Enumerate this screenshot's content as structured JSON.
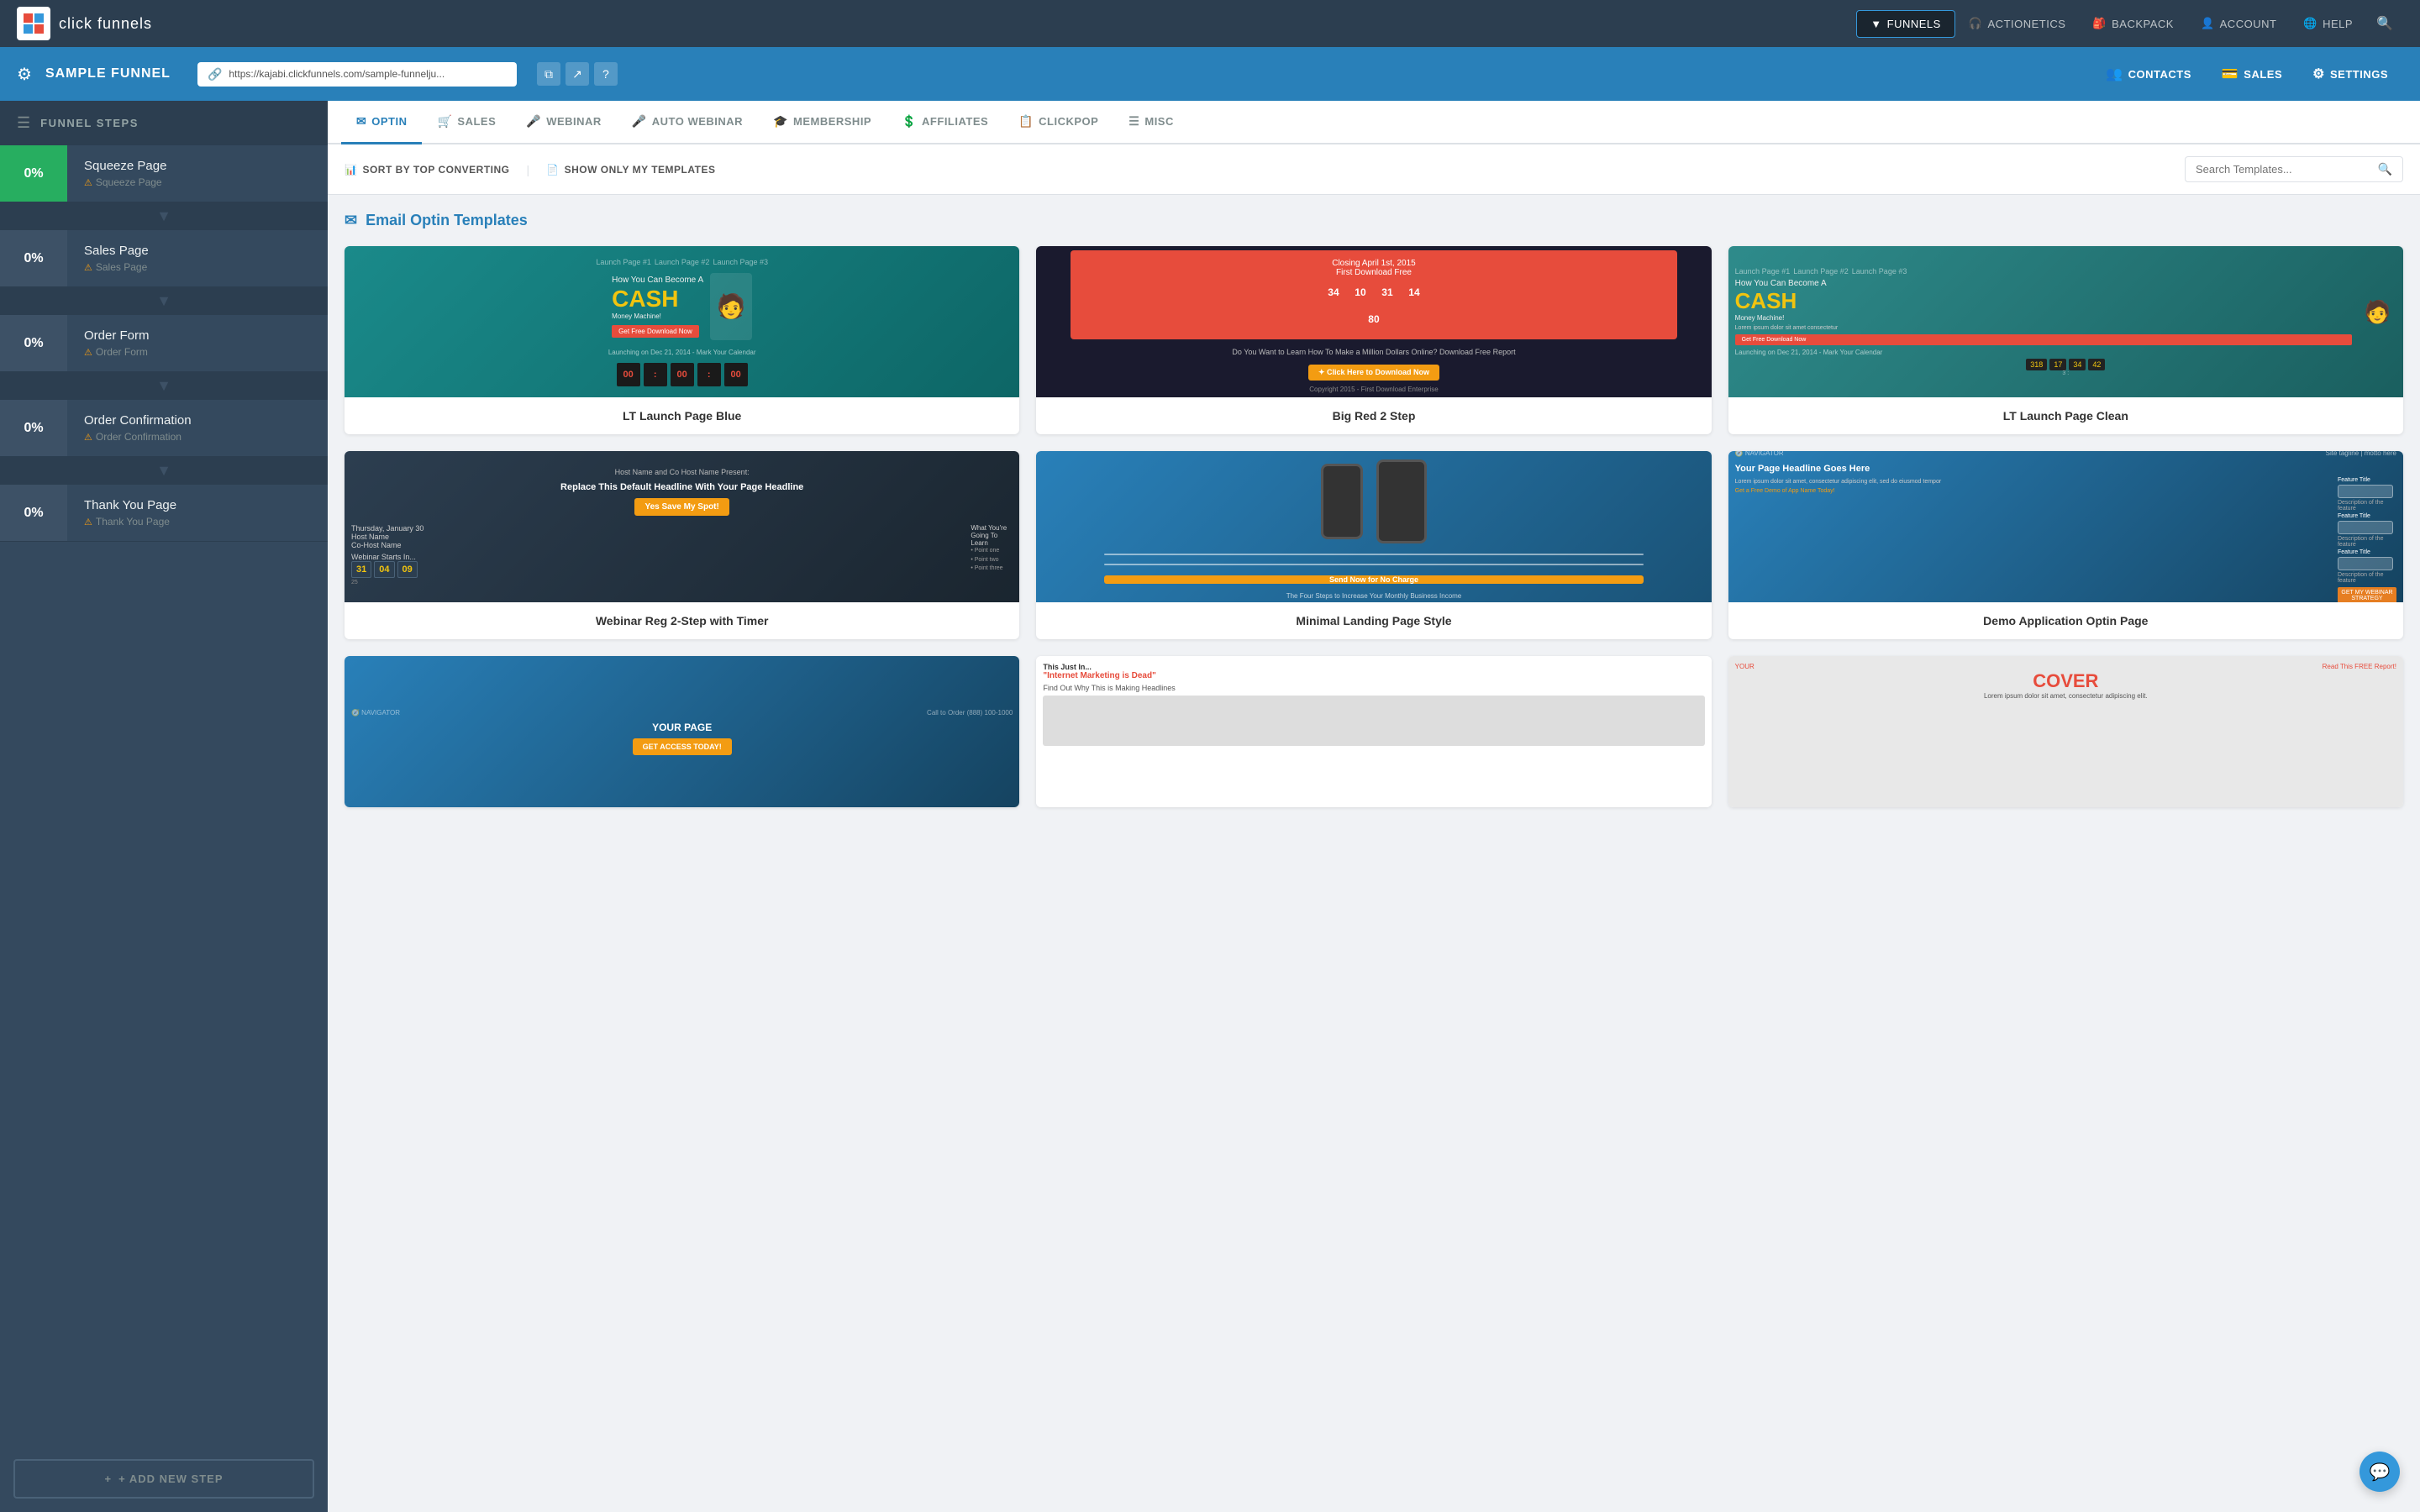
{
  "topNav": {
    "logoText": "click funnels",
    "items": [
      {
        "id": "funnels",
        "label": "FUNNELS",
        "active": true,
        "icon": "▼"
      },
      {
        "id": "actionetics",
        "label": "ACTIONETICS",
        "icon": "🎧"
      },
      {
        "id": "backpack",
        "label": "BACKPACK",
        "icon": "🎒"
      },
      {
        "id": "account",
        "label": "ACCOUNT",
        "icon": "👤"
      },
      {
        "id": "help",
        "label": "HELP",
        "icon": "🌐"
      }
    ],
    "searchIcon": "🔍"
  },
  "funnelBar": {
    "title": "SAMPLE FUNNEL",
    "url": "https://kajabi.clickfunnels.com/sample-funnelju...",
    "actions": [
      {
        "id": "contacts",
        "label": "CONTACTS",
        "icon": "👥"
      },
      {
        "id": "sales",
        "label": "SALES",
        "icon": "💳"
      },
      {
        "id": "settings",
        "label": "SETTINGS",
        "icon": "⚙"
      }
    ]
  },
  "sidebar": {
    "header": "FUNNEL STEPS",
    "steps": [
      {
        "id": "squeeze",
        "percent": "0%",
        "name": "Squeeze Page",
        "sub": "Squeeze Page",
        "active": true
      },
      {
        "id": "sales",
        "percent": "0%",
        "name": "Sales Page",
        "sub": "Sales Page",
        "active": false
      },
      {
        "id": "orderform",
        "percent": "0%",
        "name": "Order Form",
        "sub": "Order Form",
        "active": false
      },
      {
        "id": "orderconf",
        "percent": "0%",
        "name": "Order Confirmation",
        "sub": "Order Confirmation",
        "active": false
      },
      {
        "id": "thankyou",
        "percent": "0%",
        "name": "Thank You Page",
        "sub": "Thank You Page",
        "active": false
      }
    ],
    "addStepLabel": "+ ADD NEW STEP"
  },
  "tabs": [
    {
      "id": "optin",
      "label": "OPTIN",
      "icon": "✉",
      "active": true
    },
    {
      "id": "sales",
      "label": "SALES",
      "icon": "🛒",
      "active": false
    },
    {
      "id": "webinar",
      "label": "WEBINAR",
      "icon": "🎤",
      "active": false
    },
    {
      "id": "autowebinar",
      "label": "AUTO WEBINAR",
      "icon": "🎤",
      "active": false
    },
    {
      "id": "membership",
      "label": "MEMBERSHIP",
      "icon": "🎓",
      "active": false
    },
    {
      "id": "affiliates",
      "label": "AFFILIATES",
      "icon": "💲",
      "active": false
    },
    {
      "id": "clickpop",
      "label": "CLICKPOP",
      "icon": "📋",
      "active": false
    },
    {
      "id": "misc",
      "label": "MISC",
      "icon": "☰",
      "active": false
    }
  ],
  "filterBar": {
    "sortLabel": "SORT BY TOP CONVERTING",
    "showOnlyLabel": "SHOW ONLY MY TEMPLATES",
    "searchPlaceholder": "Search Templates..."
  },
  "sectionTitle": "Email Optin Templates",
  "templates": [
    {
      "id": "lt-launch-blue",
      "name": "LT Launch Page Blue",
      "thumb": "lt-blue"
    },
    {
      "id": "big-red-2step",
      "name": "Big Red 2 Step",
      "thumb": "big-red"
    },
    {
      "id": "lt-launch-clean",
      "name": "LT Launch Page Clean",
      "thumb": "lt-clean"
    },
    {
      "id": "webinar-reg",
      "name": "Webinar Reg 2-Step with Timer",
      "thumb": "webinar"
    },
    {
      "id": "minimal-landing",
      "name": "Minimal Landing Page Style",
      "thumb": "minimal"
    },
    {
      "id": "demo-application",
      "name": "Demo Application Optin Page",
      "thumb": "demo"
    }
  ]
}
